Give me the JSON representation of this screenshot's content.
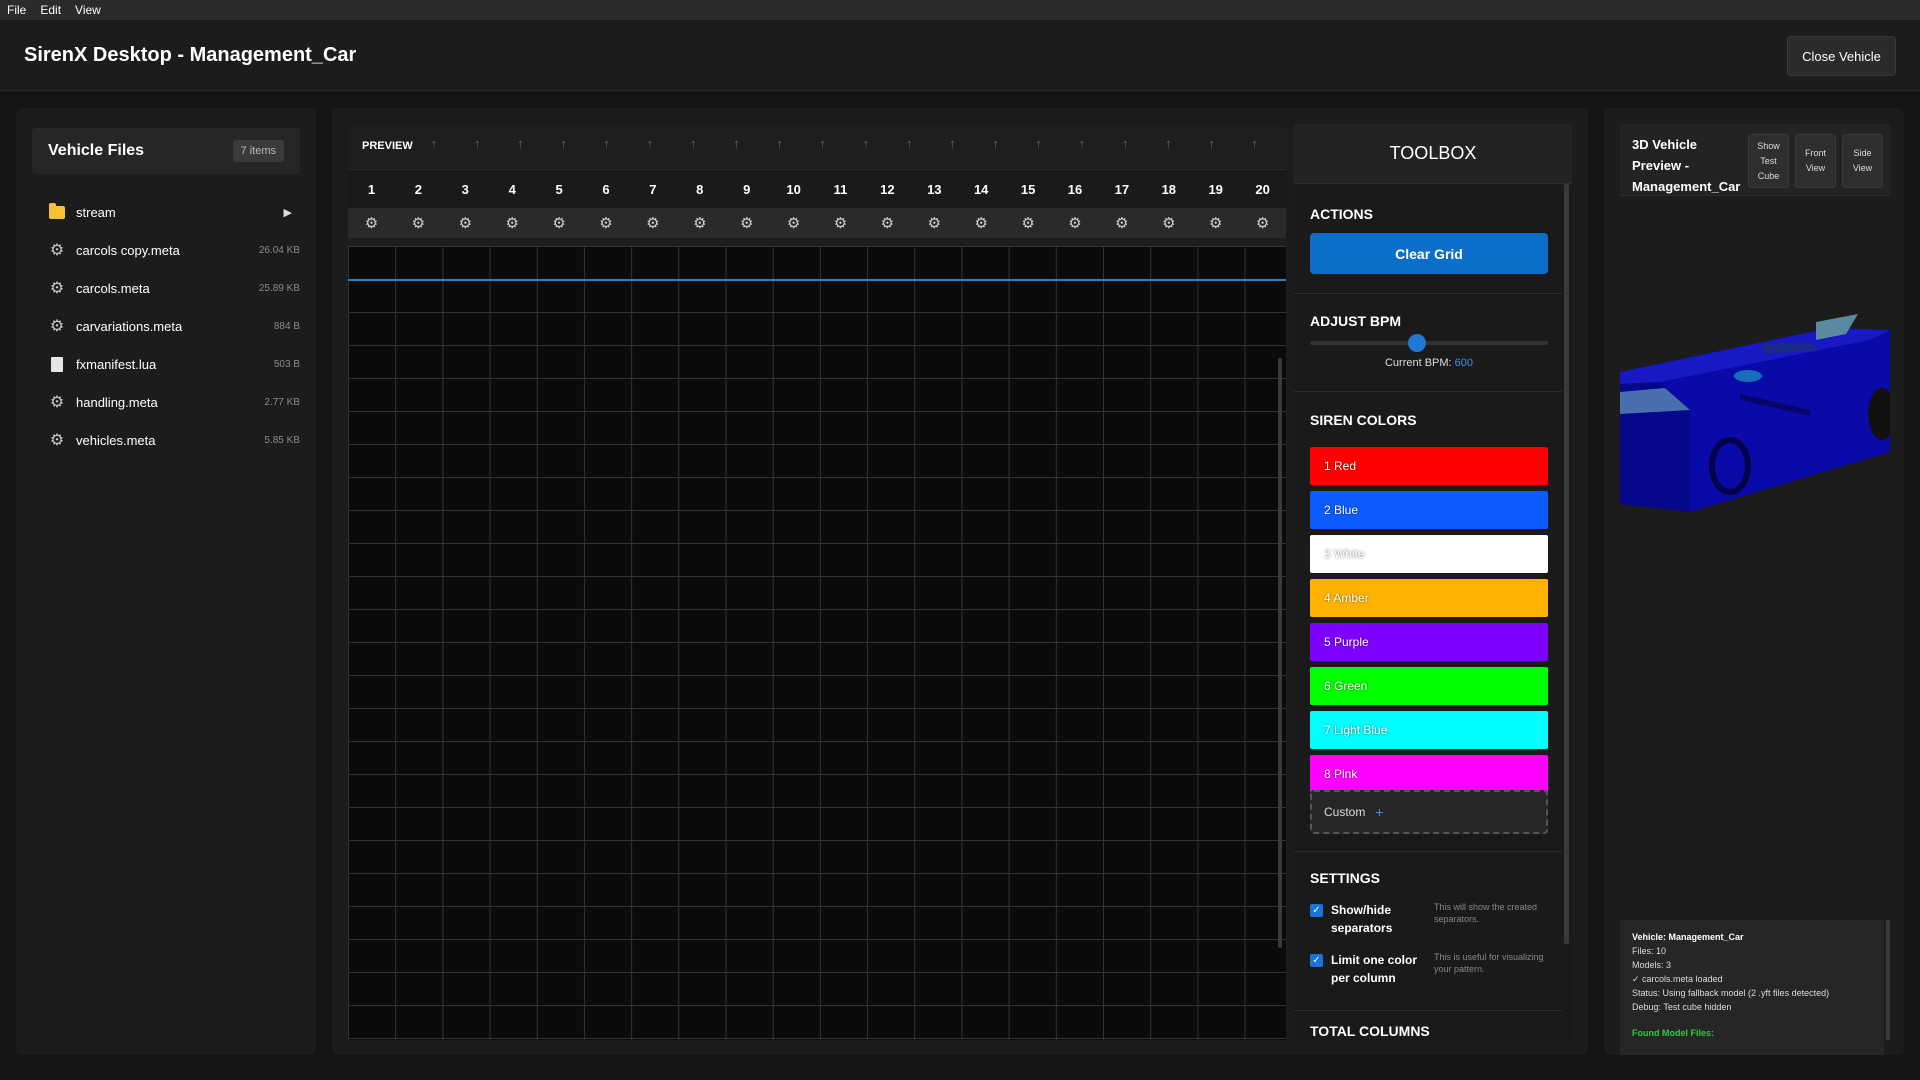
{
  "menu": [
    "File",
    "Edit",
    "View"
  ],
  "app_title": "SirenX Desktop - Management_Car",
  "close_vehicle_label": "Close Vehicle",
  "files": {
    "title": "Vehicle Files",
    "count": "7 items",
    "items": [
      {
        "name": "stream",
        "type": "folder",
        "size": ""
      },
      {
        "name": "carcols copy.meta",
        "type": "gear",
        "size": "26.04 KB"
      },
      {
        "name": "carcols.meta",
        "type": "gear",
        "size": "25.89 KB"
      },
      {
        "name": "carvariations.meta",
        "type": "gear",
        "size": "884 B"
      },
      {
        "name": "fxmanifest.lua",
        "type": "doc",
        "size": "503 B"
      },
      {
        "name": "handling.meta",
        "type": "gear",
        "size": "2.77 KB"
      },
      {
        "name": "vehicles.meta",
        "type": "gear",
        "size": "5.85 KB"
      }
    ]
  },
  "grid": {
    "preview_label": "PREVIEW",
    "columns": [
      "1",
      "2",
      "3",
      "4",
      "5",
      "6",
      "7",
      "8",
      "9",
      "10",
      "11",
      "12",
      "13",
      "14",
      "15",
      "16",
      "17",
      "18",
      "19",
      "20"
    ]
  },
  "toolbox": {
    "title": "TOOLBOX",
    "actions_title": "ACTIONS",
    "clear_grid_label": "Clear Grid",
    "bpm_title": "ADJUST BPM",
    "bpm_label": "Current BPM:",
    "bpm_value": "600",
    "bpm_fraction": 0.45,
    "colors_title": "SIREN COLORS",
    "colors": [
      {
        "label": "1 Red",
        "color": "#ff0000"
      },
      {
        "label": "2 Blue",
        "color": "#0a5cff"
      },
      {
        "label": "3 White",
        "color": "#ffffff"
      },
      {
        "label": "4 Amber",
        "color": "#ffb300"
      },
      {
        "label": "5 Purple",
        "color": "#8000ff"
      },
      {
        "label": "6 Green",
        "color": "#00ff00"
      },
      {
        "label": "7 Light Blue",
        "color": "#00ffff"
      },
      {
        "label": "8 Pink",
        "color": "#ff00ff"
      }
    ],
    "custom_label": "Custom",
    "custom_plus": "+",
    "settings_title": "SETTINGS",
    "settings": [
      {
        "label": "Show/hide separators",
        "desc": "This will show the created separators.",
        "checked": true
      },
      {
        "label": "Limit one color per column",
        "desc": "This is useful for visualizing your pattern.",
        "checked": true
      }
    ],
    "total_columns_title": "TOTAL COLUMNS"
  },
  "preview": {
    "title": "3D Vehicle Preview - Management_Car",
    "buttons": [
      "Show Test Cube",
      "Front View",
      "Side View"
    ],
    "info": {
      "vehicle": "Vehicle: Management_Car",
      "files": "Files: 10",
      "models": "Models: 3",
      "loaded": "✓ carcols.meta loaded",
      "status": "Status: Using fallback model (2 .yft files detected)",
      "debug": "Debug: Test cube hidden",
      "found": "Found Model Files:"
    }
  },
  "colors": {
    "accent": "#0b6fc9",
    "playhead": "#2f7fc6",
    "vehicle": "#0a0aa8"
  }
}
